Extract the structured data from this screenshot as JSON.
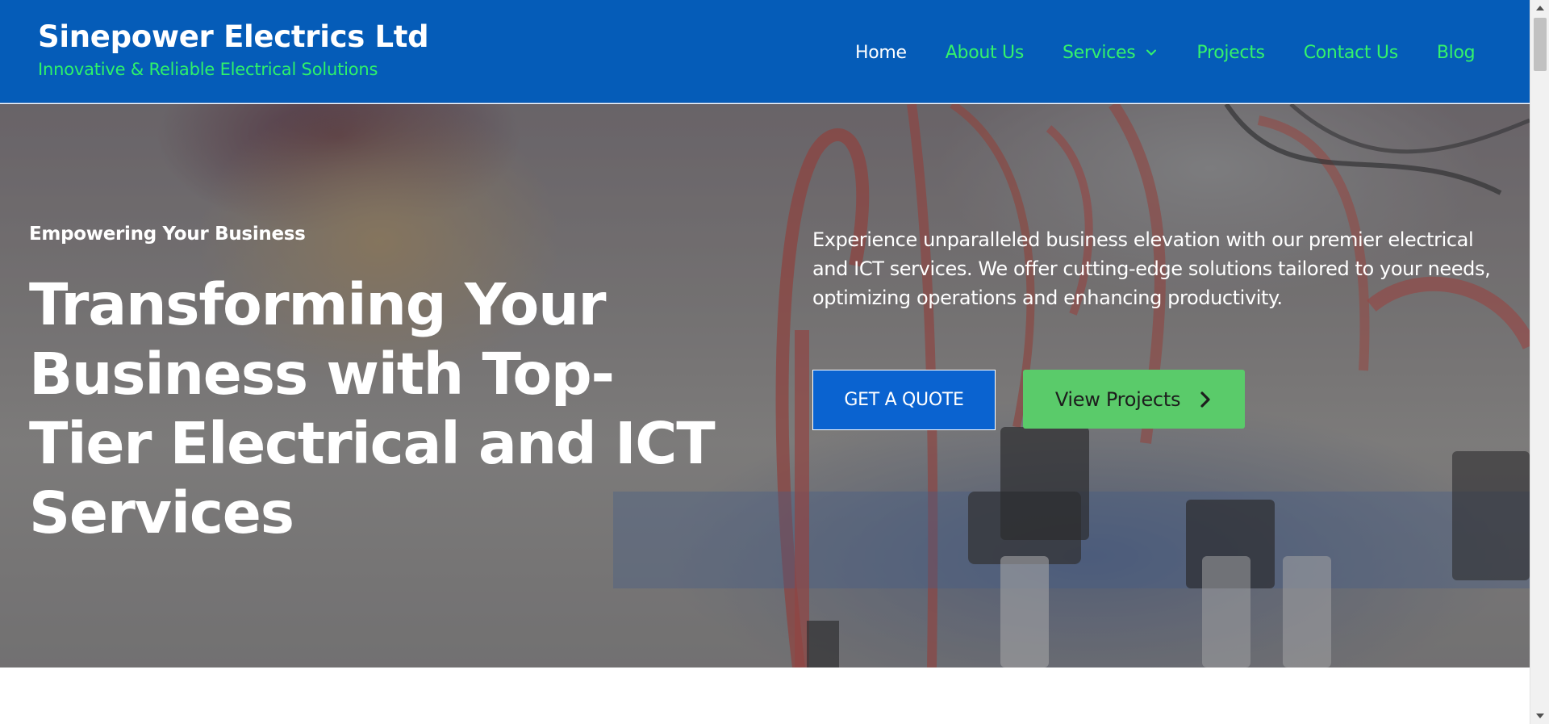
{
  "header": {
    "brand_title": "Sinepower Electrics Ltd",
    "brand_tagline": "Innovative & Reliable Electrical Solutions",
    "nav": [
      {
        "label": "Home",
        "active": true
      },
      {
        "label": "About Us"
      },
      {
        "label": "Services",
        "has_dropdown": true
      },
      {
        "label": "Projects"
      },
      {
        "label": "Contact Us"
      },
      {
        "label": "Blog"
      }
    ]
  },
  "hero": {
    "eyebrow": "Empowering Your Business",
    "headline": "Transforming Your Business with Top-Tier Electrical and ICT Services",
    "description": "Experience unparalleled business elevation with our premier electrical and ICT services. We offer cutting-edge solutions tailored to your needs, optimizing operations and enhancing productivity.",
    "primary_button": "GET A QUOTE",
    "secondary_button": "View Projects",
    "secondary_button_icon": "chevron-right-icon"
  },
  "colors": {
    "header_bg": "#055cb8",
    "nav_link": "#34f36b",
    "nav_active": "#ffffff",
    "quote_button_bg": "#0a63d0",
    "projects_button_bg": "#5acb6a"
  }
}
